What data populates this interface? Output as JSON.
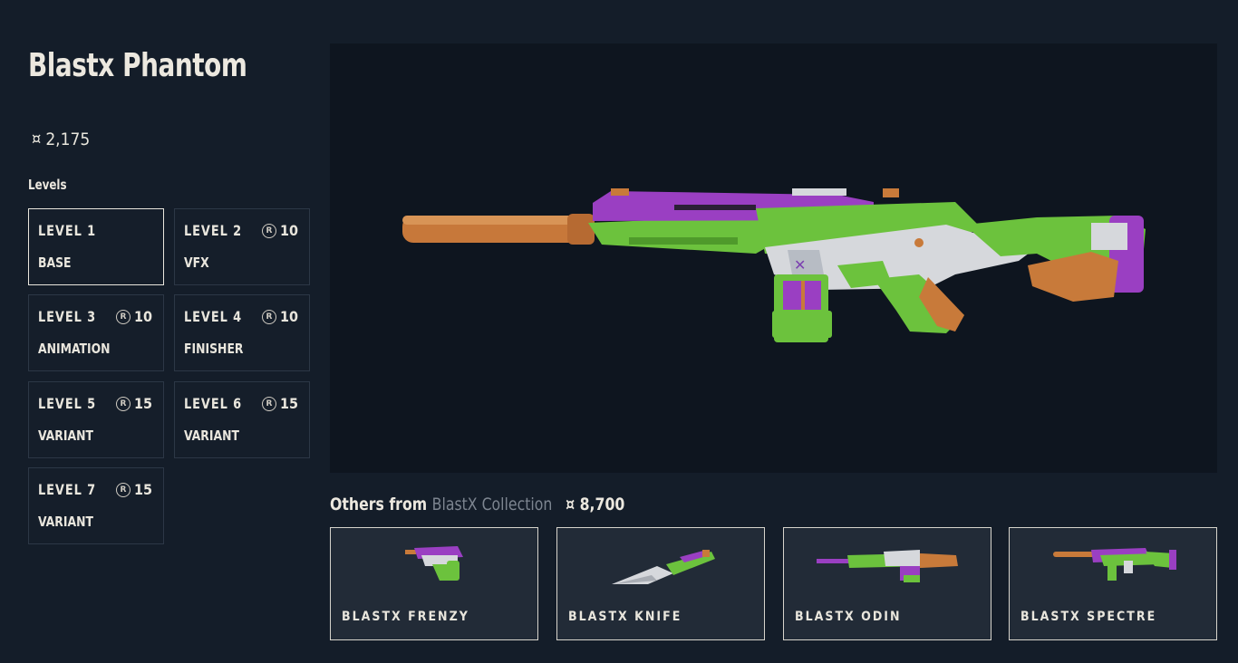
{
  "skin": {
    "title": "Blastx Phantom",
    "price": "2,175",
    "price_icon": "valorant-points-icon"
  },
  "levels_heading": "Levels",
  "levels": [
    {
      "name": "LEVEL 1",
      "type": "BASE",
      "cost": null,
      "selected": true
    },
    {
      "name": "LEVEL 2",
      "type": "VFX",
      "cost": "10"
    },
    {
      "name": "LEVEL 3",
      "type": "ANIMATION",
      "cost": "10"
    },
    {
      "name": "LEVEL 4",
      "type": "FINISHER",
      "cost": "10"
    },
    {
      "name": "LEVEL 5",
      "type": "VARIANT",
      "cost": "15"
    },
    {
      "name": "LEVEL 6",
      "type": "VARIANT",
      "cost": "15"
    },
    {
      "name": "LEVEL 7",
      "type": "VARIANT",
      "cost": "15"
    }
  ],
  "collection": {
    "prefix": "Others from",
    "name": "BlastX Collection",
    "price": "8,700",
    "items": [
      {
        "name": "BLASTX FRENZY"
      },
      {
        "name": "BLASTX KNIFE"
      },
      {
        "name": "BLASTX ODIN"
      },
      {
        "name": "BLASTX SPECTRE"
      }
    ]
  },
  "colors": {
    "background": "#141d29",
    "viewer": "#0e151f",
    "green": "#6cc23d",
    "purple": "#9a3fc2",
    "orange": "#c87a3a",
    "silver": "#d6d8dc"
  }
}
